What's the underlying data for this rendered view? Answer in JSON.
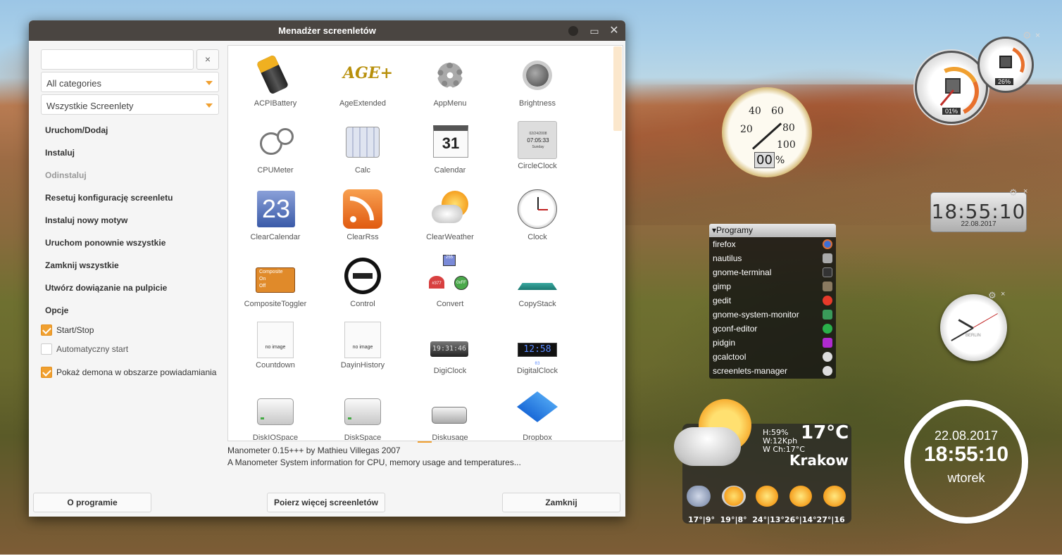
{
  "window": {
    "title": "Menadżer screenletów",
    "search_value": "",
    "search_clear": "×",
    "category_combo": "All categories",
    "filter_combo": "Wszystkie Screenlety"
  },
  "actions": [
    {
      "label": "Uruchom/Dodaj",
      "enabled": true
    },
    {
      "label": "Instaluj",
      "enabled": true
    },
    {
      "label": "Odinstaluj",
      "enabled": false
    },
    {
      "label": "Resetuj konfigurację screenletu",
      "enabled": true
    },
    {
      "label": "Instaluj nowy motyw",
      "enabled": true
    },
    {
      "label": "Uruchom ponownie wszystkie",
      "enabled": true
    },
    {
      "label": "Zamknij wszystkie",
      "enabled": true
    },
    {
      "label": "Utwórz dowiązanie na pulpicie",
      "enabled": true
    }
  ],
  "options": {
    "title": "Opcje",
    "start_stop": {
      "label": "Start/Stop",
      "checked": true
    },
    "autostart": {
      "label": "Automatyczny start",
      "checked": false
    },
    "tray": {
      "label": "Pokaż demona w obszarze powiadamiania",
      "checked": true
    }
  },
  "screenlets": [
    "ACPIBattery",
    "AgeExtended",
    "AppMenu",
    "Brightness",
    "CPUMeter",
    "Calc",
    "Calendar",
    "CircleClock",
    "ClearCalendar",
    "ClearRss",
    "ClearWeather",
    "Clock",
    "CompositeToggler",
    "Control",
    "Convert",
    "CopyStack",
    "Countdown",
    "DayinHistory",
    "DigiClock",
    "DigitalClock",
    "DiskIOSpace",
    "DiskSpace",
    "Diskusage",
    "Dropbox"
  ],
  "icon_texts": {
    "calendar_day": "31",
    "clear_calendar_day": "23",
    "circle_clock_date": "02/24/2008",
    "circle_clock_time": "07:05:33",
    "circle_clock_day": "Sunday",
    "composite_title": "Composite",
    "composite_on": "On",
    "composite_off": "Off",
    "no_image": "no image",
    "convert_top": "255",
    "convert_left": "#377",
    "convert_right": "0xFF",
    "digiclock_time": "19:31:46",
    "digitalclock_time": "12:58",
    "digitalclock_sec": "03",
    "age_text": "AGE+"
  },
  "description": {
    "line1": "Manometer 0.15+++ by Mathieu Villegas 2007",
    "line2": "A Manometer System information for CPU, memory usage and temperatures..."
  },
  "buttons": {
    "about": "O programie",
    "more": "Poierz więcej screenletów",
    "close": "Zamknij"
  },
  "desktop": {
    "cpu_meter": {
      "cpu": "01%",
      "mem": "26%"
    },
    "manometer": {
      "ticks": [
        "20",
        "40",
        "60",
        "80",
        "100",
        "0"
      ],
      "readout": "00",
      "unit": "%"
    },
    "digital_clock": {
      "time": "18:55:10",
      "date": "22.08.2017"
    },
    "programs": {
      "title": "▾Programy",
      "items": [
        "firefox",
        "nautilus",
        "gnome-terminal",
        "gimp",
        "gedit",
        "gnome-system-monitor",
        "gconf-editor",
        "pidgin",
        "gcalctool",
        "screenlets-manager"
      ]
    },
    "analog_clock": {
      "label": "BERLIN"
    },
    "weather": {
      "humidity": "H:59%",
      "wind": "W:12Kph",
      "windchill": "W Ch:17°C",
      "temp": "17°C",
      "city": "Krakow",
      "forecast": "17°|9°  19°|8°  24°|13°26°|14°27°|16"
    },
    "ring_clock": {
      "date": "22.08.2017",
      "time": "18:55:10",
      "day": "wtorek"
    }
  },
  "colors": {
    "accent": "#f0a030",
    "titlebar": "#4a4541"
  }
}
